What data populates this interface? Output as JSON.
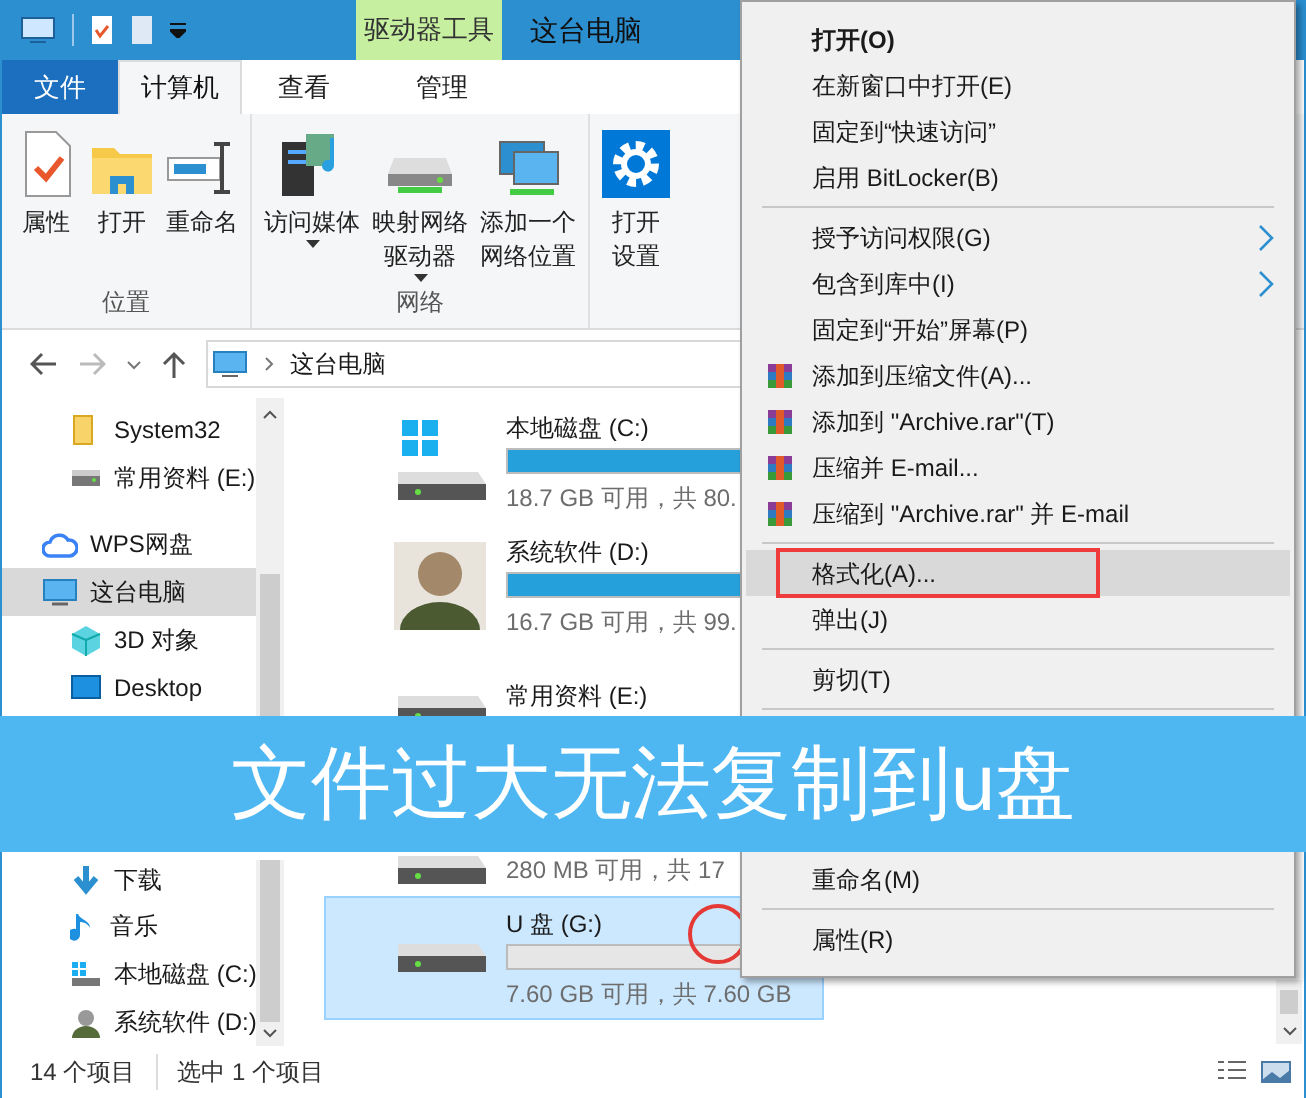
{
  "title_bar": {
    "tool_tab": "驱动器工具",
    "title": "这台电脑"
  },
  "ribbon_tabs": [
    {
      "label": "文件",
      "kind": "file",
      "selected": false
    },
    {
      "label": "计算机",
      "kind": "tab",
      "selected": true
    },
    {
      "label": "查看",
      "kind": "tab",
      "selected": false
    },
    {
      "label": "管理",
      "kind": "tool",
      "selected": false
    }
  ],
  "ribbon_groups": [
    {
      "label": "位置",
      "buttons": [
        {
          "lines": [
            "属性"
          ],
          "dropdown": false
        },
        {
          "lines": [
            "打开"
          ],
          "dropdown": false
        },
        {
          "lines": [
            "重命名"
          ],
          "dropdown": false
        }
      ]
    },
    {
      "label": "网络",
      "buttons": [
        {
          "lines": [
            "访问媒体"
          ],
          "dropdown": true
        },
        {
          "lines": [
            "映射网络",
            "驱动器"
          ],
          "dropdown": true
        },
        {
          "lines": [
            "添加一个",
            "网络位置"
          ],
          "dropdown": false
        }
      ]
    },
    {
      "buttons": [
        {
          "lines": [
            "打开",
            "设置"
          ],
          "dropdown": false
        }
      ]
    }
  ],
  "address": {
    "path": "这台电脑"
  },
  "nav_pane": {
    "scrolled_children": [
      {
        "label": "System32"
      },
      {
        "label": "常用资料 (E:)"
      }
    ],
    "items": [
      {
        "label": "WPS网盘",
        "selected": false
      },
      {
        "label": "这台电脑",
        "selected": true,
        "children": [
          {
            "label": "3D 对象",
            "selected": false
          },
          {
            "label": "Desktop",
            "selected": false
          },
          {
            "label": "下载",
            "selected": false
          },
          {
            "label": "音乐",
            "selected": false
          },
          {
            "label": "本地磁盘 (C:)",
            "selected": false
          },
          {
            "label": "系统软件 (D:)",
            "selected": false
          }
        ]
      }
    ]
  },
  "drives": [
    {
      "name": "本地磁盘 (C:)",
      "level": 0.77,
      "free": "18.7 GB 可用，共 80.",
      "selected": false
    },
    {
      "name": "系统软件 (D:)",
      "level": 0.83,
      "free": "16.7 GB 可用，共 99.",
      "selected": false
    },
    {
      "name": "常用资料 (E:)",
      "selected": false
    },
    {
      "free": "280 MB 可用，共 17",
      "selected": false
    },
    {
      "name": "U 盘 (G:)",
      "level": 0,
      "free": "7.60 GB 可用，共 7.60 GB",
      "selected": true,
      "circled": true
    }
  ],
  "context_menu": {
    "sections": [
      [
        {
          "label": "打开(O)",
          "kind": "command",
          "default": true
        },
        {
          "label": "在新窗口中打开(E)",
          "kind": "command"
        },
        {
          "label": "固定到“快速访问”",
          "kind": "command"
        },
        {
          "label": "启用 BitLocker(B)",
          "kind": "command"
        }
      ],
      [
        {
          "label": "授予访问权限(G)",
          "kind": "command",
          "submenu": true
        },
        {
          "label": "包含到库中(I)",
          "kind": "command",
          "submenu": true
        },
        {
          "label": "固定到“开始”屏幕(P)",
          "kind": "command"
        },
        {
          "label": "添加到压缩文件(A)...",
          "kind": "archive"
        },
        {
          "label": "添加到 \"Archive.rar\"(T)",
          "kind": "archive"
        },
        {
          "label": "压缩并 E-mail...",
          "kind": "archive"
        },
        {
          "label": "压缩到 \"Archive.rar\" 并 E-mail",
          "kind": "archive"
        }
      ],
      [
        {
          "label": "格式化(A)...",
          "kind": "command",
          "highlighted": true,
          "marked": true
        },
        {
          "label": "弹出(J)",
          "kind": "command"
        }
      ],
      [
        {
          "label": "剪切(T)",
          "kind": "command"
        }
      ],
      [
        {
          "label": "重命名(M)",
          "kind": "command"
        }
      ],
      [
        {
          "label": "属性(R)",
          "kind": "command"
        }
      ]
    ]
  },
  "status_bar": {
    "count": "14 个项目",
    "selection": "选中 1 个项目"
  },
  "banner": {
    "text": "文件过大无法复制到u盘"
  }
}
